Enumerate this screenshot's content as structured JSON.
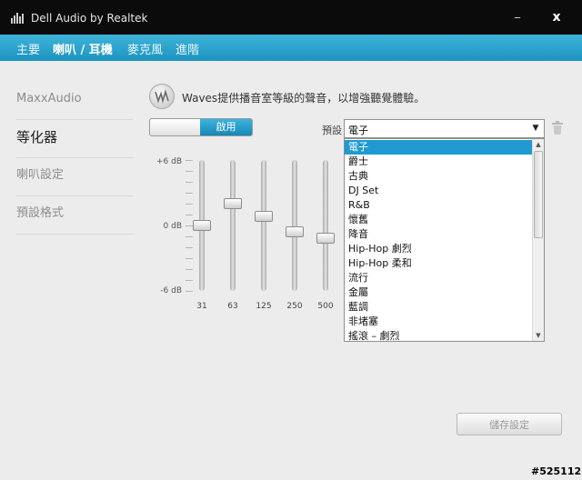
{
  "window": {
    "title": "Dell Audio by Realtek",
    "minimize_glyph": "‒",
    "close_glyph": "x"
  },
  "nav": {
    "items": [
      "主要",
      "喇叭 / 耳機",
      "麥克風",
      "進階"
    ],
    "active_index": 1
  },
  "sidebar": {
    "items": [
      "MaxxAudio",
      "等化器",
      "喇叭設定",
      "預設格式"
    ],
    "active_index": 1
  },
  "waves": {
    "description": "Waves提供播音室等級的聲音，以增強聽覺體驗。"
  },
  "toggle": {
    "on_label": "啟用",
    "state": "on"
  },
  "preset": {
    "label": "預設",
    "selected": "電子",
    "options": [
      "電子",
      "爵士",
      "古典",
      "DJ Set",
      "R&B",
      "懷舊",
      "降音",
      "Hip-Hop 劇烈",
      "Hip-Hop 柔和",
      "流行",
      "金屬",
      "藍調",
      "非堵塞",
      "搖滾 – 劇烈"
    ]
  },
  "equalizer": {
    "db_labels": [
      "+6 dB",
      "0 dB",
      "-6 dB"
    ],
    "bands": [
      {
        "freq": "31",
        "gain_db": 0
      },
      {
        "freq": "63",
        "gain_db": 2.0
      },
      {
        "freq": "125",
        "gain_db": 0.8
      },
      {
        "freq": "250",
        "gain_db": -0.6
      },
      {
        "freq": "500",
        "gain_db": -1.2
      }
    ]
  },
  "buttons": {
    "save": "儲存設定"
  },
  "watermark": "#525112",
  "colors": {
    "accent": "#1e9ad0",
    "titlebar": "#0b0b0b",
    "nav": "#2aa3cd"
  }
}
